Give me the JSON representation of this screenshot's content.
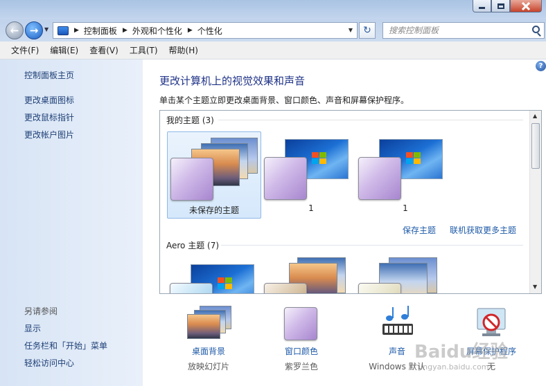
{
  "address": {
    "crumbs": [
      "控制面板",
      "外观和个性化",
      "个性化"
    ]
  },
  "search": {
    "placeholder": "搜索控制面板"
  },
  "menu": [
    "文件(F)",
    "编辑(E)",
    "查看(V)",
    "工具(T)",
    "帮助(H)"
  ],
  "sidebar": {
    "home": "控制面板主页",
    "links": [
      "更改桌面图标",
      "更改鼠标指针",
      "更改帐户图片"
    ],
    "see_also_title": "另请参阅",
    "see_also": [
      "显示",
      "任务栏和「开始」菜单",
      "轻松访问中心"
    ]
  },
  "main": {
    "title": "更改计算机上的视觉效果和声音",
    "description": "单击某个主题立即更改桌面背景、窗口颜色、声音和屏幕保护程序。",
    "my_themes_label": "我的主题 (3)",
    "my_themes": [
      {
        "name": "未保存的主题",
        "selected": true
      },
      {
        "name": "1",
        "selected": false
      },
      {
        "name": "1",
        "selected": false
      }
    ],
    "save_theme": "保存主题",
    "more_themes": "联机获取更多主题",
    "aero_label": "Aero 主题 (7)"
  },
  "settings": [
    {
      "label": "桌面背景",
      "value": "放映幻灯片",
      "icon": "desktop-background-icon"
    },
    {
      "label": "窗口颜色",
      "value": "紫罗兰色",
      "icon": "window-color-icon"
    },
    {
      "label": "声音",
      "value": "Windows 默认",
      "icon": "sound-icon"
    },
    {
      "label": "屏幕保护程序",
      "value": "无",
      "icon": "screensaver-icon"
    }
  ],
  "watermark": {
    "text": "Baidu经验",
    "url_text": "jingyan.baidu.com"
  },
  "colors": {
    "link": "#1e5aa8",
    "title": "#1e3287",
    "accent": "#1c6fd4"
  }
}
